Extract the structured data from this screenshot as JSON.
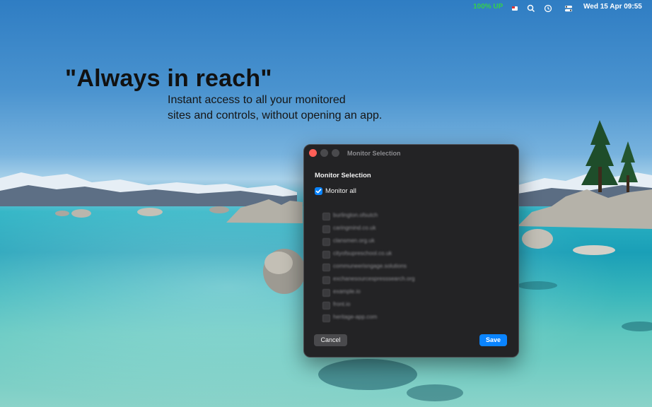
{
  "menubar": {
    "status": "100% UP",
    "clock": "Wed 15 Apr  09:55",
    "icons": [
      "app-flag-icon",
      "search-icon",
      "time-machine-icon",
      "control-center-icon"
    ],
    "status_color": "#35d04a"
  },
  "hero": {
    "headline": "\"Always in reach\"",
    "subhead_line1": "Instant access to all your monitored",
    "subhead_line2": "sites and controls, without opening an app."
  },
  "window": {
    "title": "Monitor Selection",
    "section_title": "Monitor Selection",
    "monitor_all_label": "Monitor all",
    "monitor_all_checked": true,
    "sites": [
      {
        "label": "burlington.ofsutch"
      },
      {
        "label": "caringmind.co.uk"
      },
      {
        "label": "clansmen.org.uk"
      },
      {
        "label": "cityofsupreschool.co.uk"
      },
      {
        "label": "communeerisngage.solutions"
      },
      {
        "label": "exchanesourcespresssearch.org"
      },
      {
        "label": "example.io"
      },
      {
        "label": "front.io"
      },
      {
        "label": "heritage-app.com"
      }
    ],
    "cancel_label": "Cancel",
    "save_label": "Save",
    "accent_color": "#0a84ff"
  }
}
